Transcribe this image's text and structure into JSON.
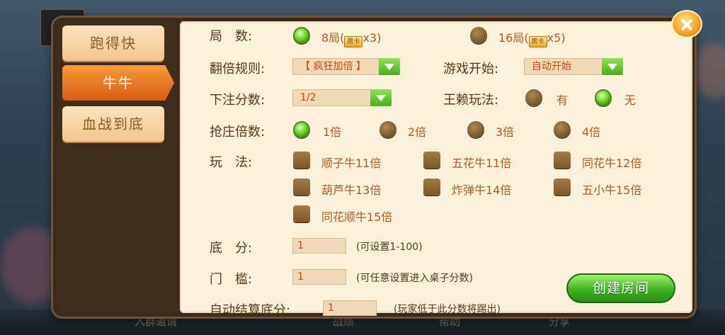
{
  "colors": {
    "accent_green": "#4eac1c",
    "tab_active": "#e57520",
    "panel_bg": "#fdf1dc"
  },
  "sidebar": {
    "tabs": [
      {
        "label": "跑得快",
        "active": false
      },
      {
        "label": "牛牛",
        "active": true
      },
      {
        "label": "血战到底",
        "active": false
      }
    ]
  },
  "form": {
    "rounds": {
      "label": "局　数:",
      "options": [
        {
          "prefix": "8局(",
          "ticket": "房卡",
          "suffix": "x3)",
          "selected": true
        },
        {
          "prefix": "16局(",
          "ticket": "房卡",
          "suffix": "x5)",
          "selected": false
        }
      ]
    },
    "double_rule": {
      "label": "翻倍规则:",
      "value": "【 疯狂加倍 】"
    },
    "game_start": {
      "label": "游戏开始:",
      "value": "自动开始"
    },
    "bet_score": {
      "label": "下注分数:",
      "value": "1/2"
    },
    "wild_play": {
      "label": "王赖玩法:",
      "options": [
        {
          "text": "有",
          "selected": false
        },
        {
          "text": "无",
          "selected": true
        }
      ]
    },
    "banker_multiplier": {
      "label": "抢庄倍数:",
      "options": [
        {
          "text": "1倍",
          "selected": true
        },
        {
          "text": "2倍",
          "selected": false
        },
        {
          "text": "3倍",
          "selected": false
        },
        {
          "text": "4倍",
          "selected": false
        }
      ]
    },
    "play_rules": {
      "label": "玩　法:",
      "options": [
        "顺子牛11倍",
        "五花牛11倍",
        "同花牛12倍",
        "葫芦牛13倍",
        "炸弹牛14倍",
        "五小牛15倍",
        "同花顺牛15倍"
      ]
    },
    "base_score": {
      "label": "底　分:",
      "value": "1",
      "hint": "(可设置1-100)"
    },
    "threshold": {
      "label": "门　槛:",
      "value": "1",
      "hint": "(可任意设置进入桌子分数)"
    },
    "auto_settle": {
      "label": "自动结算底分:",
      "value": "1",
      "hint": "(玩家低于此分数将踢出)"
    }
  },
  "buttons": {
    "create_room": "创建房间"
  },
  "footer": {
    "invite": "入群邀请",
    "record": "战绩",
    "help": "帮助",
    "share": "分享"
  }
}
